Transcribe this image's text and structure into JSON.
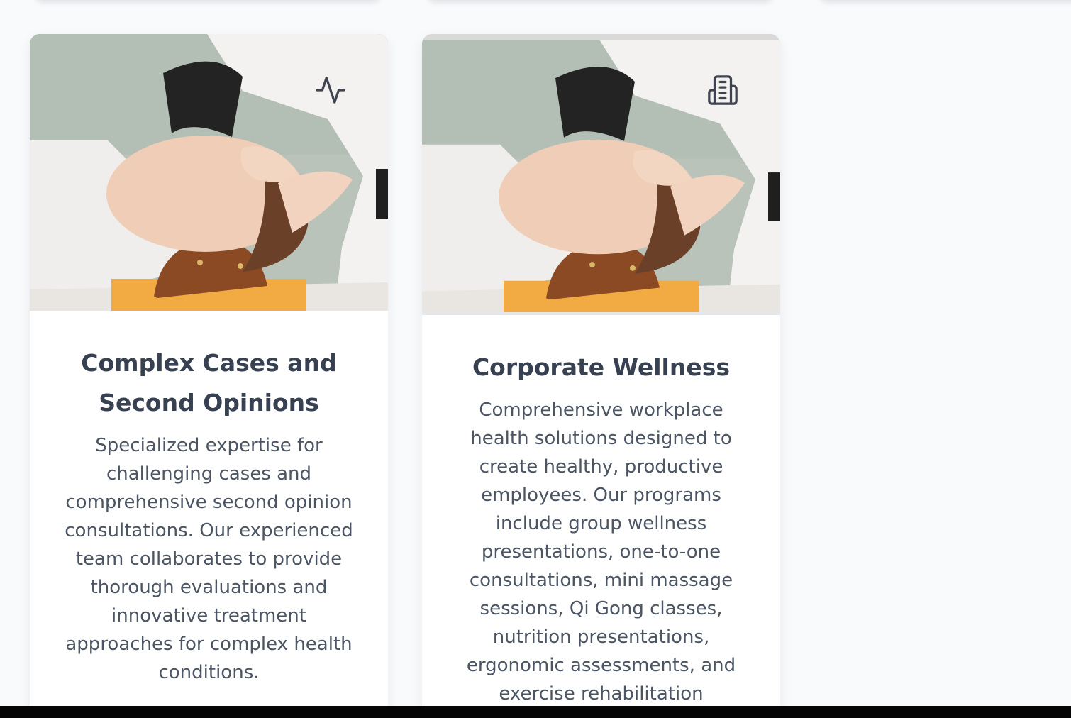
{
  "cards": [
    {
      "title": "Complex Cases and Second Opinions",
      "description": "Specialized expertise for challenging cases and comprehensive second opinion consultations. Our experienced team collaborates to provide thorough evaluations and innovative treatment approaches for complex health conditions.",
      "icon": "activity-icon"
    },
    {
      "title": "Corporate Wellness",
      "description": "Comprehensive workplace health solutions designed to create healthy, productive employees. Our programs include group wellness presentations, one-to-one consultations, mini massage sessions, Qi Gong classes, nutrition presentations, ergonomic assessments, and exercise rehabilitation",
      "icon": "building-icon"
    }
  ],
  "colors": {
    "page_background": "#f8fafc",
    "card_background": "#ffffff",
    "title_text": "#374151",
    "body_text": "#4b5563",
    "icon_stroke": "#3f4450",
    "bottom_bar": "#050505"
  }
}
